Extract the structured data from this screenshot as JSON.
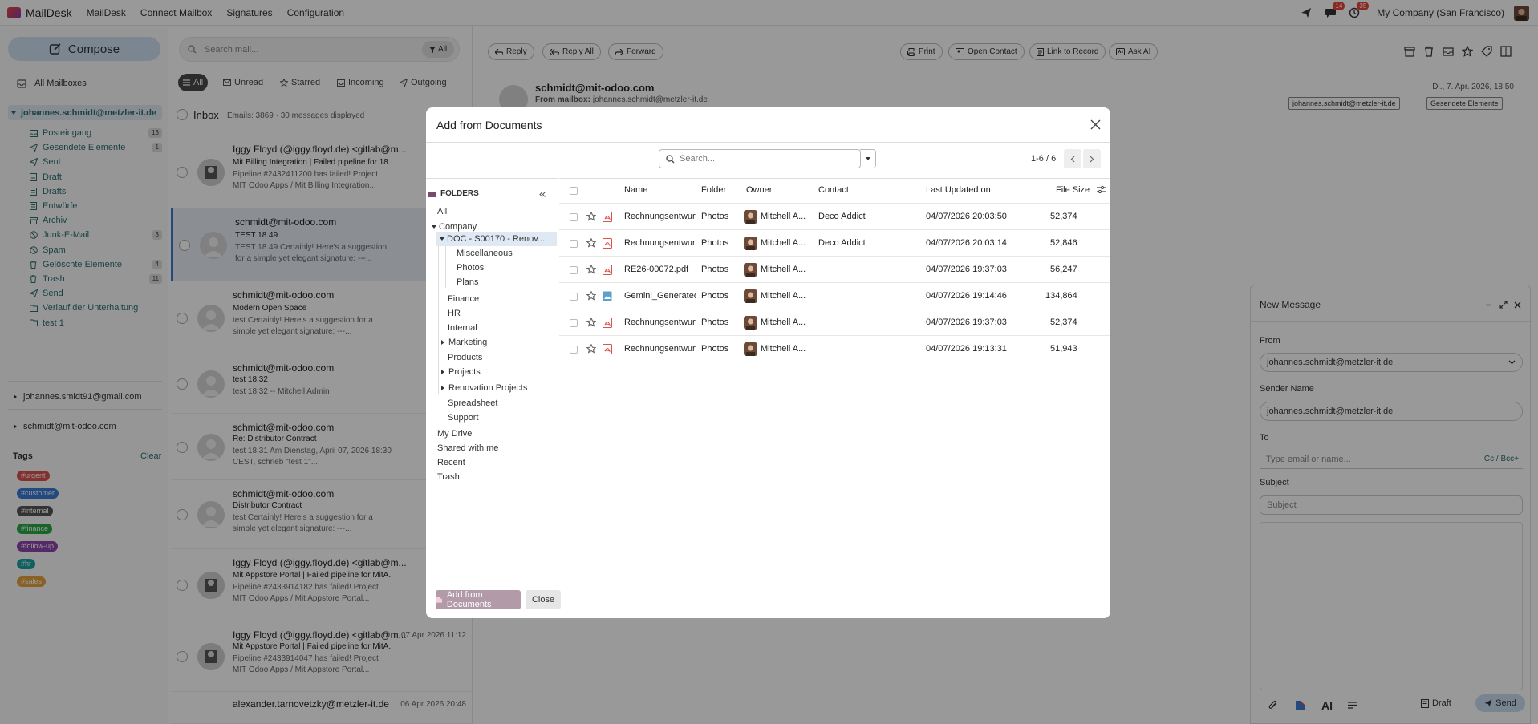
{
  "topbar": {
    "brand": "MailDesk",
    "menu": [
      "MailDesk",
      "Connect Mailbox",
      "Signatures",
      "Configuration"
    ],
    "chat_badge": "14",
    "activity_badge": "35",
    "company": "My Company (San Francisco)"
  },
  "sidebar": {
    "compose_label": "Compose",
    "all_mailboxes": "All Mailboxes",
    "account": "johannes.schmidt@metzler-it.de",
    "folders": [
      {
        "label": "Posteingang",
        "count": "13"
      },
      {
        "label": "Gesendete Elemente",
        "count": "1"
      },
      {
        "label": "Sent",
        "count": ""
      },
      {
        "label": "Draft",
        "count": ""
      },
      {
        "label": "Drafts",
        "count": ""
      },
      {
        "label": "Entwürfe",
        "count": ""
      },
      {
        "label": "Archiv",
        "count": ""
      },
      {
        "label": "Junk-E-Mail",
        "count": "3"
      },
      {
        "label": "Spam",
        "count": ""
      },
      {
        "label": "Gelöschte Elemente",
        "count": "4"
      },
      {
        "label": "Trash",
        "count": "11"
      },
      {
        "label": "Send",
        "count": ""
      },
      {
        "label": "Verlauf der Unterhaltung",
        "count": ""
      },
      {
        "label": "test 1",
        "count": ""
      }
    ],
    "other_accounts": [
      "johannes.smidt91@gmail.com",
      "schmidt@mit-odoo.com"
    ],
    "tags_title": "Tags",
    "tags_clear": "Clear",
    "tags": [
      {
        "label": "#urgent",
        "color": "#d9534f"
      },
      {
        "label": "#customer",
        "color": "#3a7bd5"
      },
      {
        "label": "#internal",
        "color": "#555555"
      },
      {
        "label": "#finance",
        "color": "#28a745"
      },
      {
        "label": "#follow-up",
        "color": "#8e44ad"
      },
      {
        "label": "#hr",
        "color": "#17a2a2"
      },
      {
        "label": "#sales",
        "color": "#e6a23c"
      }
    ]
  },
  "maillist": {
    "search_placeholder": "Search mail...",
    "filter_all_btn": "All",
    "filters": [
      "All",
      "Unread",
      "Starred",
      "Incoming",
      "Outgoing"
    ],
    "inbox_title": "Inbox",
    "inbox_stats": "Emails: 3869 · 30 messages displayed",
    "mails": [
      {
        "from": "Iggy Floyd (@iggy.floyd.de) <gitlab@m...",
        "date": "07 Apr 20",
        "subject": "Mit Billing Integration | Failed pipeline for 18....",
        "preview": "Pipeline #2432411200 has failed! Project MIT Odoo Apps / Mit Billing Integration..."
      },
      {
        "from": "schmidt@mit-odoo.com",
        "date": "07 Apr 20",
        "subject": "TEST 18.49",
        "preview": "TEST 18.49 Certainly! Here's a suggestion for a simple yet elegant signature: ---..."
      },
      {
        "from": "schmidt@mit-odoo.com",
        "date": "07 Apr 20",
        "subject": "Modern Open Space",
        "preview": "test Certainly! Here's a suggestion for a simple yet elegant signature: ---..."
      },
      {
        "from": "schmidt@mit-odoo.com",
        "date": "07 Apr 20",
        "subject": "test 18.32",
        "preview": "test 18.32 -- Mitchell Admin"
      },
      {
        "from": "schmidt@mit-odoo.com",
        "date": "07 Apr 20",
        "subject": "Re: Distributor Contract",
        "preview": "test 18.31 Am Dienstag, April 07, 2026 18:30 CEST, schrieb \"test 1\"..."
      },
      {
        "from": "schmidt@mit-odoo.com",
        "date": "07 Apr 20",
        "subject": "Distributor Contract",
        "preview": "test Certainly! Here's a suggestion for a simple yet elegant signature: ---..."
      },
      {
        "from": "Iggy Floyd (@iggy.floyd.de) <gitlab@m...",
        "date": "07 Apr 20",
        "subject": "Mit Appstore Portal | Failed pipeline for MitA...",
        "preview": "Pipeline #2433914182 has failed! Project MIT Odoo Apps / Mit Appstore Portal..."
      },
      {
        "from": "Iggy Floyd (@iggy.floyd.de) <gitlab@m...",
        "date": "07 Apr 2026 11:12",
        "subject": "Mit Appstore Portal | Failed pipeline for MitA...",
        "preview": "Pipeline #2433914047 has failed! Project MIT Odoo Apps / Mit Appstore Portal..."
      },
      {
        "from": "alexander.tarnovetzky@metzler-it.de",
        "date": "06 Apr 2026 20:48",
        "subject": "",
        "preview": ""
      }
    ]
  },
  "reader": {
    "buttons": [
      "Reply",
      "Reply All",
      "Forward",
      "Print",
      "Open Contact",
      "Link to Record",
      "Ask AI"
    ],
    "from": "schmidt@mit-odoo.com",
    "mailbox_label": "From mailbox:",
    "mailbox_value": "johannes.schmidt@metzler-it.de",
    "date": "Di., 7. Apr. 2026, 18:50",
    "chip_account": "johannes.schmidt@metzler-it.de",
    "chip_folder": "Gesendete Elemente"
  },
  "newmsg": {
    "title": "New Message",
    "from_label": "From",
    "from_value": "johannes.schmidt@metzler-it.de",
    "sender_label": "Sender Name",
    "sender_value": "johannes.schmidt@metzler-it.de",
    "to_label": "To",
    "to_placeholder": "Type email or name...",
    "ccbcc": "Cc / Bcc+",
    "subject_label": "Subject",
    "subject_placeholder": "Subject",
    "ai_label": "AI",
    "draft_label": "Draft",
    "send_label": "Send"
  },
  "modal": {
    "title": "Add from Documents",
    "search_placeholder": "Search...",
    "pager": "1-6 / 6",
    "folders_title": "FOLDERS",
    "folder_tree": {
      "all": "All",
      "company": "Company",
      "doc": "DOC - S00170 - Renov...",
      "doc_children": [
        "Miscellaneous",
        "Photos",
        "Plans"
      ],
      "company_children": [
        "Finance",
        "HR",
        "Internal",
        "Marketing",
        "Products",
        "Projects",
        "Renovation Projects",
        "Spreadsheet",
        "Support"
      ],
      "bottom": [
        "My Drive",
        "Shared with me",
        "Recent",
        "Trash"
      ]
    },
    "columns": [
      "Name",
      "Folder",
      "Owner",
      "Contact",
      "Last Updated on",
      "File Size"
    ],
    "rows": [
      {
        "name": "Rechnungsentwurf (...",
        "folder": "Photos",
        "owner": "Mitchell A...",
        "contact": "Deco Addict",
        "updated": "04/07/2026 20:03:50",
        "size": "52,374",
        "type": "pdf"
      },
      {
        "name": "Rechnungsentwurf (...",
        "folder": "Photos",
        "owner": "Mitchell A...",
        "contact": "Deco Addict",
        "updated": "04/07/2026 20:03:14",
        "size": "52,846",
        "type": "pdf"
      },
      {
        "name": "RE26-00072.pdf",
        "folder": "Photos",
        "owner": "Mitchell A...",
        "contact": "",
        "updated": "04/07/2026 19:37:03",
        "size": "56,247",
        "type": "pdf"
      },
      {
        "name": "Gemini_Generated_I...",
        "folder": "Photos",
        "owner": "Mitchell A...",
        "contact": "",
        "updated": "04/07/2026 19:14:46",
        "size": "134,864",
        "type": "image"
      },
      {
        "name": "Rechnungsentwurf (...",
        "folder": "Photos",
        "owner": "Mitchell A...",
        "contact": "",
        "updated": "04/07/2026 19:37:03",
        "size": "52,374",
        "type": "pdf"
      },
      {
        "name": "Rechnungsentwurf (...",
        "folder": "Photos",
        "owner": "Mitchell A...",
        "contact": "",
        "updated": "04/07/2026 19:13:31",
        "size": "51,943",
        "type": "pdf"
      }
    ],
    "add_button": "Add from Documents",
    "close_button": "Close"
  }
}
